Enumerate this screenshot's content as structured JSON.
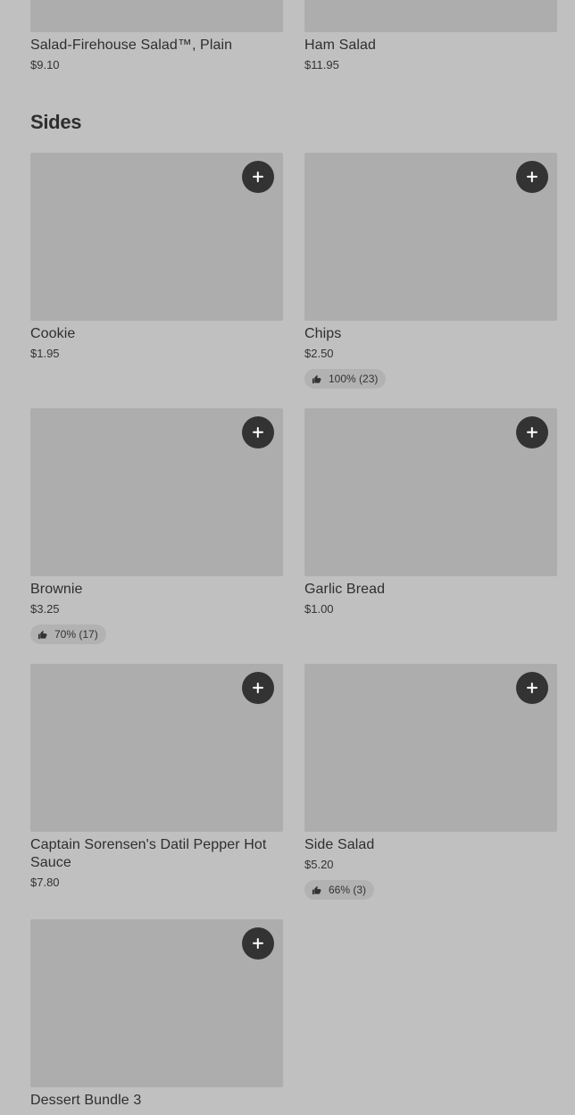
{
  "top_items": [
    {
      "name": "Salad-Firehouse Salad™, Plain",
      "price": "$9.10"
    },
    {
      "name": "Ham Salad",
      "price": "$11.95"
    }
  ],
  "sides": {
    "title": "Sides",
    "items": [
      {
        "name": "Cookie",
        "price": "$1.95"
      },
      {
        "name": "Chips",
        "price": "$2.50",
        "rating": "100% (23)"
      },
      {
        "name": "Brownie",
        "price": "$3.25",
        "rating": "70% (17)"
      },
      {
        "name": "Garlic Bread",
        "price": "$1.00"
      },
      {
        "name": "Captain Sorensen's Datil Pepper Hot Sauce",
        "price": "$7.80"
      },
      {
        "name": "Side Salad",
        "price": "$5.20",
        "rating": "66% (3)"
      },
      {
        "name": "Dessert Bundle 3",
        "price": ""
      }
    ]
  },
  "icons": {
    "add": "plus-icon",
    "rating": "thumbs-up-icon"
  },
  "colors": {
    "background": "#c0c0c0",
    "image_placeholder": "#adadad",
    "add_button": "#333333",
    "rating_pill": "#b2b2b2"
  }
}
